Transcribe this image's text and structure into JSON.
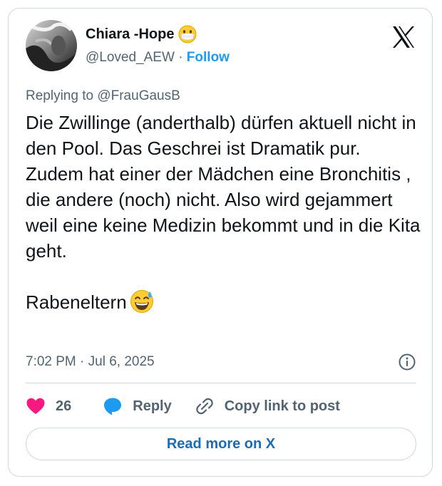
{
  "author": {
    "display_name": "Chiara -Hope",
    "name_emoji": "face-with-medical-mask-icon",
    "handle": "@Loved_AEW",
    "separator": "·",
    "follow_label": "Follow"
  },
  "reply_context": {
    "text": "Replying to @FrauGausB"
  },
  "tweet": {
    "paragraph_1": "Die Zwillinge (anderthalb) dürfen aktuell nicht in den Pool. Das Geschrei ist Dramatik pur. Zudem hat einer der Mädchen eine Bronchitis , die andere (noch) nicht. Also wird gejammert weil eine keine Medizin bekommt und in die Kita geht.",
    "paragraph_2": "Rabeneltern",
    "paragraph_2_emoji": "grinning-face-with-sweat-icon"
  },
  "meta": {
    "timestamp": "7:02 PM · Jul 6, 2025"
  },
  "actions": {
    "like_count": "26",
    "reply_label": "Reply",
    "copy_link_label": "Copy link to post"
  },
  "footer": {
    "read_more_label": "Read more on X"
  },
  "colors": {
    "accent_blue": "#1d9bf0",
    "like_pink": "#f91880",
    "secondary_text": "#536471",
    "border": "#cfd9de"
  }
}
